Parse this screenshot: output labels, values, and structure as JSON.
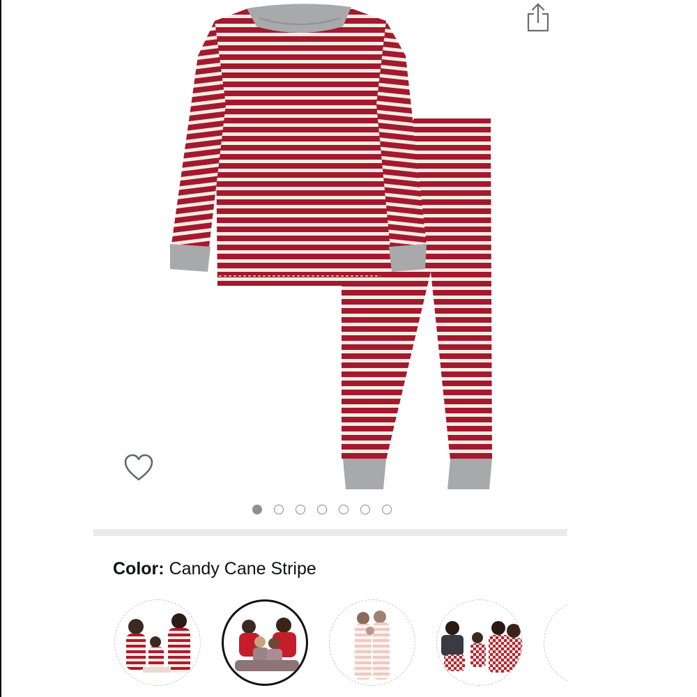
{
  "product": {
    "color_label": "Color:",
    "color_value": "Candy Cane Stripe"
  },
  "carousel": {
    "total": 7,
    "active_index": 0
  },
  "swatches": [
    {
      "selected": false
    },
    {
      "selected": true
    },
    {
      "selected": false
    },
    {
      "selected": false
    },
    {
      "selected": false
    }
  ],
  "colors": {
    "stripe_red": "#a3192d",
    "stripe_cream": "#f6ece4",
    "heather_gray": "#a7a9ab",
    "divider": "#eaeaea",
    "selected_border": "#111111"
  },
  "icons": [
    "share-icon",
    "heart-icon"
  ]
}
